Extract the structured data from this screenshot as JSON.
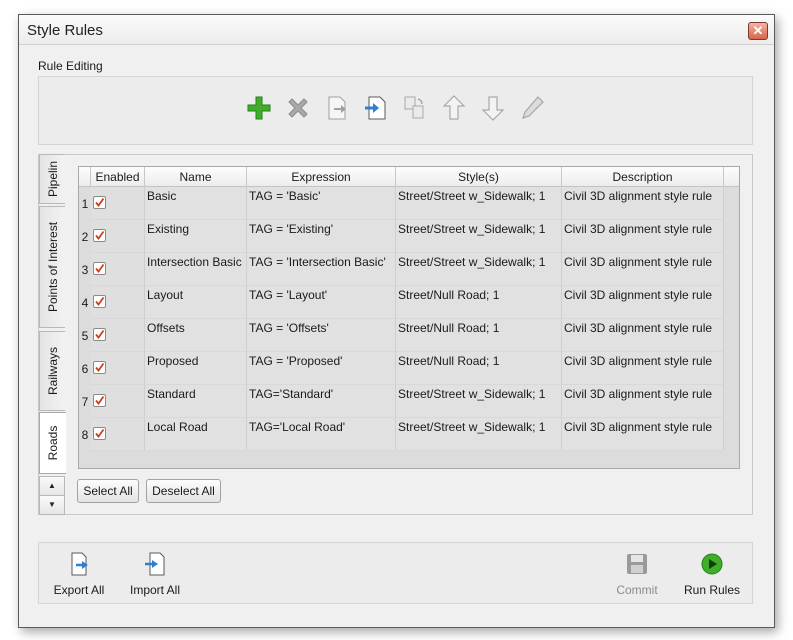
{
  "window": {
    "title": "Style Rules",
    "close_glyph": "✕"
  },
  "rule_editing": {
    "label": "Rule Editing",
    "toolbar": [
      {
        "name": "add-rule-button",
        "icon": "plus-icon",
        "enabled": true
      },
      {
        "name": "delete-rule-button",
        "icon": "x-icon",
        "enabled": false
      },
      {
        "name": "export-rule-button",
        "icon": "export-doc-icon",
        "enabled": false
      },
      {
        "name": "import-rule-button",
        "icon": "import-doc-icon",
        "enabled": true
      },
      {
        "name": "copy-rule-button",
        "icon": "copy-icon",
        "enabled": false
      },
      {
        "name": "move-up-button",
        "icon": "arrow-up-icon",
        "enabled": false
      },
      {
        "name": "move-down-button",
        "icon": "arrow-down-icon",
        "enabled": false
      },
      {
        "name": "edit-rule-button",
        "icon": "pencil-icon",
        "enabled": false
      }
    ]
  },
  "tabs": [
    {
      "label": "Pipelin",
      "active": false
    },
    {
      "label": "Points of Interest",
      "active": false
    },
    {
      "label": "Railways",
      "active": false
    },
    {
      "label": "Roads",
      "active": true
    }
  ],
  "table": {
    "columns": [
      "Enabled",
      "Name",
      "Expression",
      "Style(s)",
      "Description"
    ],
    "rows": [
      {
        "num": "1",
        "enabled": true,
        "name": "Basic",
        "expression": "TAG = 'Basic'",
        "styles": "Street/Street w_Sidewalk; 1",
        "description": "Civil 3D alignment style rule"
      },
      {
        "num": "2",
        "enabled": true,
        "name": "Existing",
        "expression": "TAG = 'Existing'",
        "styles": "Street/Street w_Sidewalk; 1",
        "description": "Civil 3D alignment style rule"
      },
      {
        "num": "3",
        "enabled": true,
        "name": "Intersection Basic",
        "expression": "TAG = 'Intersection Basic'",
        "styles": "Street/Street w_Sidewalk; 1",
        "description": "Civil 3D alignment style rule"
      },
      {
        "num": "4",
        "enabled": true,
        "name": "Layout",
        "expression": "TAG = 'Layout'",
        "styles": "Street/Null Road; 1",
        "description": "Civil 3D alignment style rule"
      },
      {
        "num": "5",
        "enabled": true,
        "name": "Offsets",
        "expression": "TAG = 'Offsets'",
        "styles": "Street/Null Road; 1",
        "description": "Civil 3D alignment style rule"
      },
      {
        "num": "6",
        "enabled": true,
        "name": "Proposed",
        "expression": "TAG = 'Proposed'",
        "styles": "Street/Null Road; 1",
        "description": "Civil 3D alignment style rule"
      },
      {
        "num": "7",
        "enabled": true,
        "name": "Standard",
        "expression": "TAG='Standard'",
        "styles": "Street/Street w_Sidewalk; 1",
        "description": "Civil 3D alignment style rule"
      },
      {
        "num": "8",
        "enabled": true,
        "name": "Local Road",
        "expression": "TAG='Local Road'",
        "styles": "Street/Street w_Sidewalk; 1",
        "description": "Civil 3D alignment style rule"
      }
    ]
  },
  "selection": {
    "select_all": "Select All",
    "deselect_all": "Deselect All"
  },
  "bottom": {
    "export_all": "Export All",
    "import_all": "Import All",
    "commit": "Commit",
    "run_rules": "Run Rules"
  },
  "colors": {
    "accent_green": "#3fae2a",
    "accent_blue": "#2f7fd0",
    "check_red": "#c8401c"
  }
}
